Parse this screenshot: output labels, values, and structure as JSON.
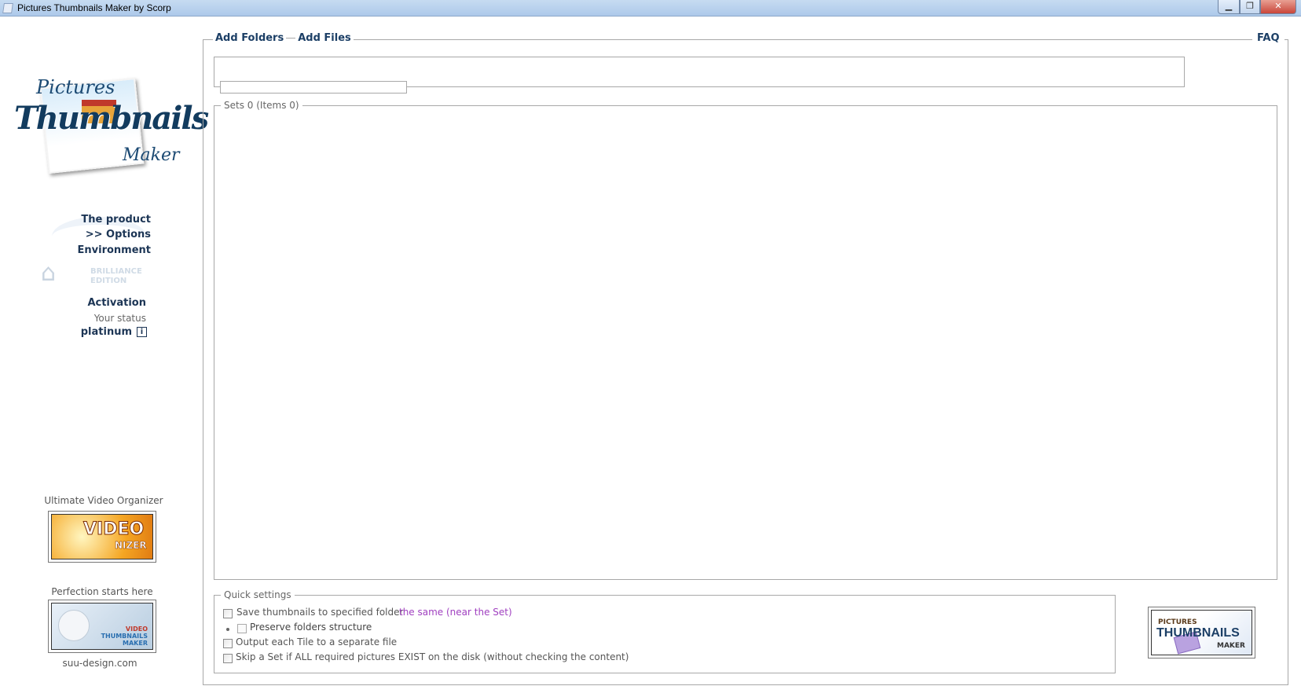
{
  "window": {
    "title": "Pictures Thumbnails Maker by Scorp",
    "controls": [
      "minimize",
      "restore",
      "close"
    ]
  },
  "logo": {
    "line1": "Pictures",
    "line2": "Thumbnails",
    "line3": "Maker"
  },
  "sidebar": {
    "nav": [
      {
        "label": "The product"
      },
      {
        "label": ">> Options"
      },
      {
        "label": "Environment"
      }
    ],
    "edition": {
      "line1": "BRILLIANCE",
      "line2": "EDITION"
    },
    "activation": {
      "label": "Activation",
      "status_label": "Your status",
      "status_value": "platinum"
    },
    "promo1": {
      "caption": "Ultimate Video Organizer",
      "banner_text1": "VIDEO",
      "banner_text2": "NIZER"
    },
    "promo2": {
      "caption": "Perfection starts here",
      "banner_text1": "VIDEO",
      "banner_text2": "THUMBNAILS",
      "banner_text3": "MAKER"
    },
    "site": "suu-design.com"
  },
  "header": {
    "add_folders": "Add Folders",
    "add_files": "Add Files",
    "faq": "FAQ"
  },
  "path": {
    "value": ""
  },
  "sets": {
    "legend": "Sets 0 (Items 0)"
  },
  "quick_settings": {
    "legend": "Quick settings",
    "options": [
      {
        "label": "Save thumbnails to specified folder",
        "checked": false,
        "link": "the same (near the Set)"
      },
      {
        "label": "Preserve folders structure",
        "checked": false
      },
      {
        "label": "Output each Tile to a separate file",
        "checked": false
      },
      {
        "label": "Skip a Set if ALL required pictures EXIST on the disk (without checking the content)",
        "checked": false
      }
    ]
  },
  "badge": {
    "line1": "PICTURES",
    "line2": "THUMBNAILS",
    "line3": "MAKER"
  },
  "colors": {
    "link": "#1c3f66",
    "accent_link": "#a040c0",
    "titlebar": "#b8d1ee",
    "close": "#c9463a"
  }
}
